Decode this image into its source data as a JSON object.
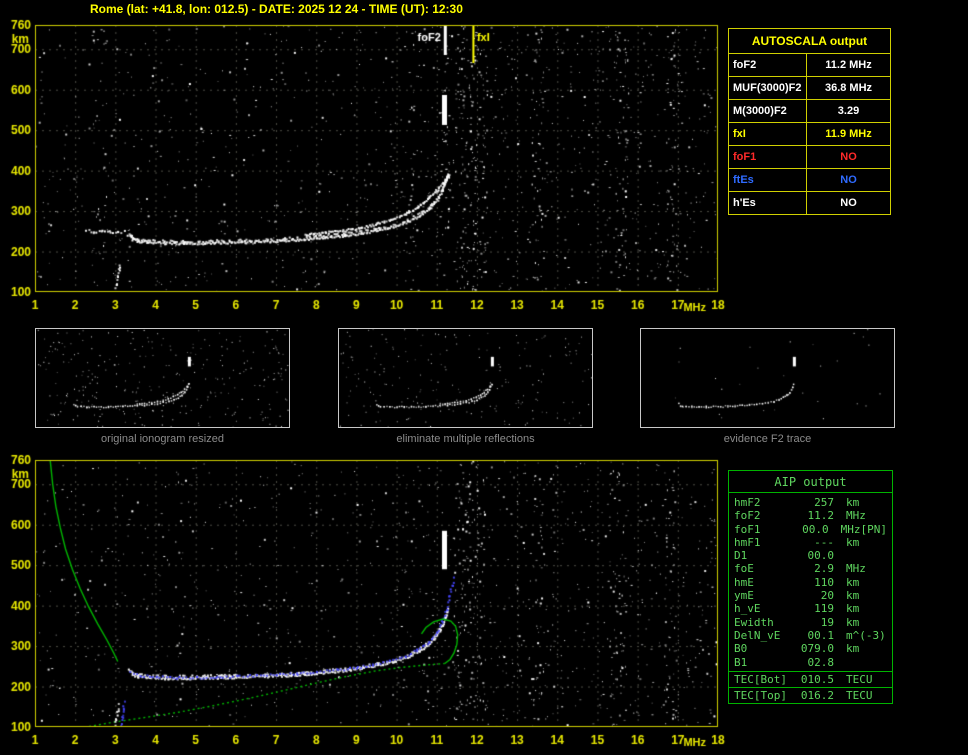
{
  "header": {
    "title": "Rome (lat: +41.8, lon: 012.5) - DATE: 2025 12 24 - TIME (UT): 12:30"
  },
  "colors": {
    "background": "#000000",
    "title_yellow": "#ffff00",
    "plot_border": "#d0d000",
    "axis_label": "#e8e800",
    "grid": "#4c4c44",
    "trace_white": "#ffffff",
    "trace_blue": "#4646ff",
    "profile_green": "#00b400",
    "autoscala_border": "#d0d000",
    "aip_border": "#00b300",
    "aip_text": "#5fd65f",
    "caption_gray": "#8c8c8c",
    "status_red": "#ff2a2a",
    "status_blue": "#2f6bff"
  },
  "autoscala": {
    "title": "AUTOSCALA output",
    "rows": [
      {
        "label": "foF2",
        "value": "11.2 MHz",
        "color": "#ffffff"
      },
      {
        "label": "MUF(3000)F2",
        "value": "36.8 MHz",
        "color": "#ffffff"
      },
      {
        "label": "M(3000)F2",
        "value": "3.29",
        "color": "#ffffff"
      },
      {
        "label": "fxI",
        "value": "11.9 MHz",
        "color": "#ffff00"
      },
      {
        "label": "foF1",
        "value": "NO",
        "color": "#ff2a2a"
      },
      {
        "label": "ftEs",
        "value": "NO",
        "color": "#2f6bff"
      },
      {
        "label": "h'Es",
        "value": "NO",
        "color": "#ffffff"
      }
    ]
  },
  "thumbnails": [
    {
      "caption": "original ionogram resized"
    },
    {
      "caption": "eliminate multiple reflections"
    },
    {
      "caption": "evidence F2 trace"
    }
  ],
  "aip": {
    "title": "AIP output",
    "rows": [
      {
        "label": "hmF2",
        "value": "257",
        "unit": "km",
        "extra": ""
      },
      {
        "label": "foF2",
        "value": "11.2",
        "unit": "MHz",
        "extra": ""
      },
      {
        "label": "foF1",
        "value": "00.0",
        "unit": "MHz",
        "extra": "[PN]"
      },
      {
        "label": "hmF1",
        "value": "---",
        "unit": "km",
        "extra": ""
      },
      {
        "label": "D1",
        "value": "00.0",
        "unit": "",
        "extra": ""
      },
      {
        "label": "foE",
        "value": "2.9",
        "unit": "MHz",
        "extra": ""
      },
      {
        "label": "hmE",
        "value": "110",
        "unit": "km",
        "extra": ""
      },
      {
        "label": "ymE",
        "value": "20",
        "unit": "km",
        "extra": ""
      },
      {
        "label": "h_vE",
        "value": "119",
        "unit": "km",
        "extra": ""
      },
      {
        "label": "Ewidth",
        "value": "19",
        "unit": "km",
        "extra": ""
      },
      {
        "label": "DelN_vE",
        "value": "00.1",
        "unit": "m^(-3)",
        "extra": ""
      },
      {
        "label": "B0",
        "value": "079.0",
        "unit": "km",
        "extra": ""
      },
      {
        "label": "B1",
        "value": "02.8",
        "unit": "",
        "extra": ""
      }
    ],
    "tec_rows": [
      {
        "label": "TEC[Bot]",
        "value": "010.5",
        "unit": "TECU"
      },
      {
        "label": "TEC[Top]",
        "value": "016.2",
        "unit": "TECU"
      }
    ]
  },
  "chart_data": [
    {
      "id": "autoscaled_ionogram",
      "type": "scatter",
      "title": "autoscaled ionogram",
      "xlabel": "MHz",
      "ylabel": "km",
      "xlim": [
        1,
        18
      ],
      "ylim": [
        100,
        760
      ],
      "x_ticks": [
        1,
        2,
        3,
        4,
        5,
        6,
        7,
        8,
        9,
        10,
        11,
        12,
        13,
        14,
        15,
        16,
        17,
        18
      ],
      "y_ticks": [
        100,
        200,
        300,
        400,
        500,
        600,
        700,
        760
      ],
      "grid": true,
      "markers": [
        {
          "label": "foF2",
          "x": 11.2,
          "color": "#ffffff",
          "side": "left",
          "len": 30
        },
        {
          "label": "fxI",
          "x": 11.9,
          "color": "#ffff00",
          "side": "right",
          "len": 38
        }
      ],
      "series": [
        {
          "name": "F2-trace-ordinary",
          "color": "#ffffff",
          "render": "pixels",
          "thick": true,
          "points": [
            [
              3.3,
              244
            ],
            [
              3.42,
              232
            ],
            [
              3.55,
              227
            ],
            [
              3.8,
              225
            ],
            [
              4.2,
              223
            ],
            [
              4.7,
              222
            ],
            [
              5.2,
              223
            ],
            [
              5.7,
              224
            ],
            [
              6.2,
              225
            ],
            [
              6.7,
              227
            ],
            [
              7.2,
              229
            ],
            [
              7.7,
              232
            ],
            [
              8.2,
              236
            ],
            [
              8.7,
              241
            ],
            [
              9.1,
              247
            ],
            [
              9.5,
              254
            ],
            [
              9.9,
              263
            ],
            [
              10.25,
              275
            ],
            [
              10.55,
              290
            ],
            [
              10.8,
              308
            ],
            [
              11.0,
              330
            ],
            [
              11.12,
              352
            ],
            [
              11.2,
              372
            ],
            [
              11.26,
              388
            ]
          ]
        },
        {
          "name": "F2-trace-extraordinary",
          "color": "#ffffff",
          "render": "pixels",
          "points": [
            [
              7.7,
              243
            ],
            [
              8.2,
              248
            ],
            [
              8.7,
              254
            ],
            [
              9.1,
              261
            ],
            [
              9.5,
              270
            ],
            [
              9.85,
              281
            ],
            [
              10.2,
              295
            ],
            [
              10.5,
              312
            ],
            [
              10.75,
              331
            ],
            [
              10.98,
              353
            ],
            [
              11.15,
              373
            ],
            [
              11.3,
              390
            ]
          ]
        },
        {
          "name": "leading-scatter",
          "color": "#ffffff",
          "render": "dots",
          "points": [
            [
              2.25,
              256
            ],
            [
              2.45,
              249
            ],
            [
              2.65,
              252
            ],
            [
              2.85,
              251
            ],
            [
              3.05,
              249
            ],
            [
              3.2,
              252
            ]
          ]
        },
        {
          "name": "E-region-echo",
          "color": "#ffffff",
          "render": "dots",
          "points": [
            [
              2.98,
              104
            ],
            [
              3.01,
              122
            ],
            [
              3.04,
              140
            ],
            [
              3.07,
              158
            ],
            [
              3.1,
              170
            ]
          ]
        }
      ]
    },
    {
      "id": "profile_ionogram",
      "type": "scatter",
      "title": "ionogram with restored trace and electron density profile",
      "xlabel": "MHz",
      "ylabel": "km",
      "xlim": [
        1,
        18
      ],
      "ylim": [
        100,
        760
      ],
      "x_ticks": [
        1,
        2,
        3,
        4,
        5,
        6,
        7,
        8,
        9,
        10,
        11,
        12,
        13,
        14,
        15,
        16,
        17,
        18
      ],
      "y_ticks": [
        100,
        200,
        300,
        400,
        500,
        600,
        700,
        760
      ],
      "grid": true,
      "markers": [],
      "series": [
        {
          "name": "F2-trace",
          "color": "#ffffff",
          "render": "pixels",
          "thick": true,
          "points": [
            [
              3.3,
              244
            ],
            [
              3.42,
              232
            ],
            [
              3.55,
              227
            ],
            [
              3.8,
              225
            ],
            [
              4.2,
              223
            ],
            [
              4.7,
              222
            ],
            [
              5.2,
              223
            ],
            [
              5.7,
              224
            ],
            [
              6.2,
              225
            ],
            [
              6.7,
              227
            ],
            [
              7.2,
              229
            ],
            [
              7.7,
              232
            ],
            [
              8.2,
              236
            ],
            [
              8.7,
              241
            ],
            [
              9.1,
              247
            ],
            [
              9.5,
              254
            ],
            [
              9.9,
              263
            ],
            [
              10.25,
              275
            ],
            [
              10.55,
              290
            ],
            [
              10.8,
              308
            ],
            [
              11.0,
              330
            ],
            [
              11.12,
              352
            ],
            [
              11.2,
              372
            ],
            [
              11.26,
              388
            ]
          ]
        },
        {
          "name": "restored-trace",
          "color": "#4646ff",
          "render": "dots",
          "points": [
            [
              3.35,
              240
            ],
            [
              3.6,
              229
            ],
            [
              4.0,
              226
            ],
            [
              4.5,
              224
            ],
            [
              5.0,
              224
            ],
            [
              5.5,
              225
            ],
            [
              6.0,
              227
            ],
            [
              6.5,
              229
            ],
            [
              7.0,
              231
            ],
            [
              7.5,
              234
            ],
            [
              8.0,
              238
            ],
            [
              8.5,
              243
            ],
            [
              9.0,
              249
            ],
            [
              9.4,
              256
            ],
            [
              9.8,
              265
            ],
            [
              10.2,
              277
            ],
            [
              10.5,
              292
            ],
            [
              10.8,
              312
            ],
            [
              11.0,
              336
            ],
            [
              11.12,
              362
            ],
            [
              11.22,
              393
            ],
            [
              11.3,
              425
            ],
            [
              11.36,
              452
            ],
            [
              11.4,
              470
            ]
          ]
        },
        {
          "name": "topside-profile",
          "color": "#00b400",
          "render": "line",
          "points": [
            [
              1.38,
              758
            ],
            [
              1.44,
              700
            ],
            [
              1.52,
              645
            ],
            [
              1.63,
              592
            ],
            [
              1.76,
              540
            ],
            [
              1.93,
              490
            ],
            [
              2.12,
              443
            ],
            [
              2.33,
              398
            ],
            [
              2.56,
              355
            ],
            [
              2.79,
              315
            ],
            [
              2.96,
              283
            ],
            [
              3.06,
              262
            ]
          ]
        },
        {
          "name": "bottomside-profile",
          "color": "#00b400",
          "render": "dotline",
          "points": [
            [
              2.1,
              97
            ],
            [
              2.5,
              104
            ],
            [
              2.9,
              111
            ],
            [
              3.3,
              117
            ],
            [
              3.9,
              126
            ],
            [
              4.6,
              137
            ],
            [
              5.3,
              150
            ],
            [
              6.0,
              164
            ],
            [
              6.7,
              179
            ],
            [
              7.4,
              195
            ],
            [
              8.1,
              211
            ],
            [
              8.8,
              226
            ],
            [
              9.5,
              239
            ],
            [
              10.1,
              247
            ],
            [
              10.7,
              253
            ],
            [
              11.2,
              257
            ]
          ]
        },
        {
          "name": "peak-arc",
          "color": "#00b400",
          "render": "line",
          "points": [
            [
              11.2,
              257
            ],
            [
              11.33,
              267
            ],
            [
              11.43,
              283
            ],
            [
              11.5,
              304
            ],
            [
              11.52,
              328
            ],
            [
              11.47,
              349
            ],
            [
              11.35,
              362
            ],
            [
              11.15,
              367
            ],
            [
              10.92,
              360
            ],
            [
              10.73,
              346
            ],
            [
              10.62,
              330
            ]
          ]
        },
        {
          "name": "E-region-echo",
          "color": "#ffffff",
          "render": "dots",
          "points": [
            [
              2.98,
              104
            ],
            [
              3.01,
              122
            ],
            [
              3.04,
              140
            ],
            [
              3.07,
              158
            ]
          ]
        },
        {
          "name": "E-region-restored",
          "color": "#4646ff",
          "render": "dots",
          "points": [
            [
              3.12,
              104
            ],
            [
              3.15,
              125
            ],
            [
              3.18,
              146
            ],
            [
              3.2,
              165
            ]
          ]
        }
      ]
    }
  ]
}
